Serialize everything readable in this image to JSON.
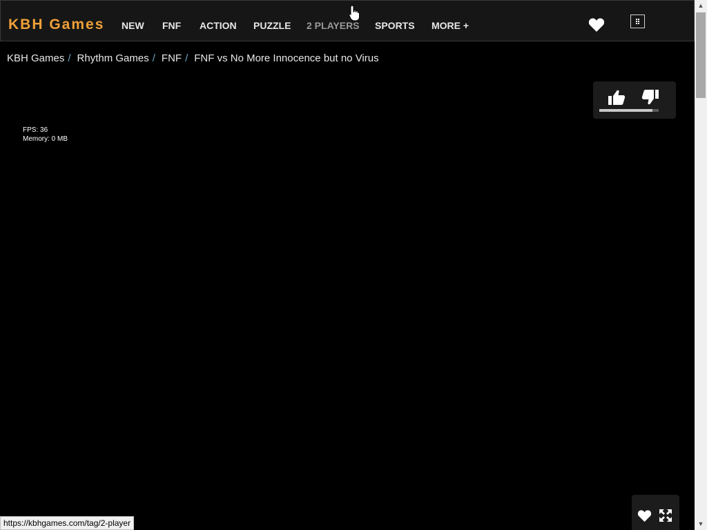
{
  "header": {
    "logo": "KBH Games",
    "nav": [
      {
        "label": "NEW"
      },
      {
        "label": "FNF"
      },
      {
        "label": "ACTION"
      },
      {
        "label": "PUZZLE"
      },
      {
        "label": "2 PLAYERS"
      },
      {
        "label": "SPORTS"
      },
      {
        "label": "MORE +"
      }
    ],
    "favorites_icon": "heart-icon",
    "menu_icon": "grid-menu-icon"
  },
  "breadcrumb": {
    "items": [
      "KBH Games",
      "Rhythm Games",
      "FNF"
    ],
    "separator": "/",
    "current": "FNF vs No More Innocence but no Virus"
  },
  "vote": {
    "like_icon": "thumbs-up-icon",
    "dislike_icon": "thumbs-down-icon",
    "like_ratio": 0.9
  },
  "game_stats": {
    "fps": "FPS: 36",
    "memory": "Memory: 0 MB"
  },
  "bottom_controls": {
    "favorite_icon": "heart-icon",
    "fullscreen_icon": "fullscreen-icon"
  },
  "status_bar": {
    "url": "https://kbhgames.com/tag/2-player"
  },
  "colors": {
    "brand": "#f0a138",
    "background": "#000000",
    "header_bg": "#161616",
    "breadcrumb_separator": "#6aa6c8"
  }
}
